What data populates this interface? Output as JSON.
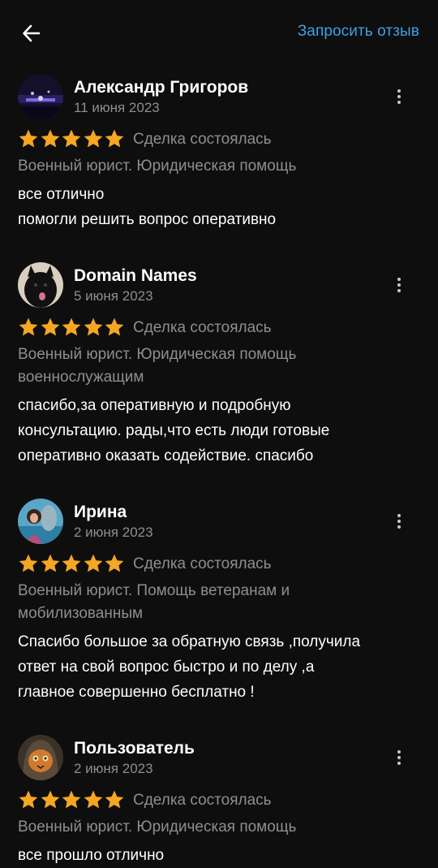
{
  "header": {
    "back_icon": "arrow-left-icon",
    "request_review": "Запросить отзыв",
    "accent_color": "#3ea0e6"
  },
  "reviews": [
    {
      "name": "Александр Григоров",
      "date": "11 июня 2023",
      "rating": 5,
      "deal_status": "Сделка состоялась",
      "service": "Военный юрист. Юридическая помощь",
      "text_lines": [
        "все отлично",
        "помогли решить вопрос оперативно"
      ]
    },
    {
      "name": "Domain Names",
      "date": "5 июня 2023",
      "rating": 5,
      "deal_status": "Сделка состоялась",
      "service": "Военный юрист. Юридическая помощь военнослужащим",
      "text_lines": [
        "спасибо,за оперативную и подробную",
        "консультацию. рады,что есть люди готовые",
        "оперативно оказать содействие. спасибо"
      ]
    },
    {
      "name": "Ирина",
      "date": "2 июня 2023",
      "rating": 5,
      "deal_status": "Сделка состоялась",
      "service": "Военный юрист. Помощь ветеранам и мобилизованным",
      "text_lines": [
        "Спасибо большое за обратную связь ,получила",
        "ответ на свой вопрос быстро и по делу ,а",
        "главное совершенно бесплатно !"
      ]
    },
    {
      "name": "Пользователь",
      "date": "2 июня 2023",
      "rating": 5,
      "deal_status": "Сделка состоялась",
      "service": "Военный юрист. Юридическая помощь",
      "text_lines": [
        "все прошло отлично"
      ]
    }
  ],
  "colors": {
    "background": "#0e0e0e",
    "star": "#f5a623",
    "secondary_text": "#8e8e8e"
  }
}
